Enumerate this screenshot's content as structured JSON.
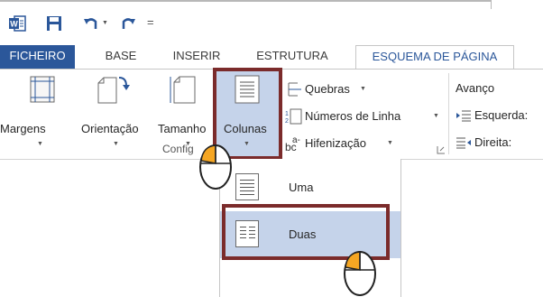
{
  "qat": {
    "word_icon": "word-icon",
    "save_icon": "save-icon",
    "undo_icon": "undo-icon",
    "redo_icon": "redo-icon",
    "customize_glyph": "="
  },
  "tabs": [
    {
      "label": "FICHEIRO"
    },
    {
      "label": "BASE"
    },
    {
      "label": "INSERIR"
    },
    {
      "label": "ESTRUTURA"
    },
    {
      "label": "ESQUEMA DE PÁGINA"
    }
  ],
  "ribbon": {
    "margens": "Margens",
    "orientacao": "Orientação",
    "tamanho": "Tamanho",
    "colunas": "Colunas",
    "quebras": "Quebras",
    "numeros_linha": "Números de Linha",
    "hifenizacao": "Hifenização",
    "group_label": "Config",
    "avanco": "Avanço",
    "esquerda": "Esquerda:",
    "direita": "Direita:"
  },
  "menu": {
    "items": [
      {
        "label": "Uma"
      },
      {
        "label": "Duas"
      }
    ]
  },
  "colors": {
    "accent": "#2b579a",
    "highlight": "#c5d3ea",
    "annotation_box": "#7b2b2b",
    "mouse_button": "#f5a623"
  }
}
